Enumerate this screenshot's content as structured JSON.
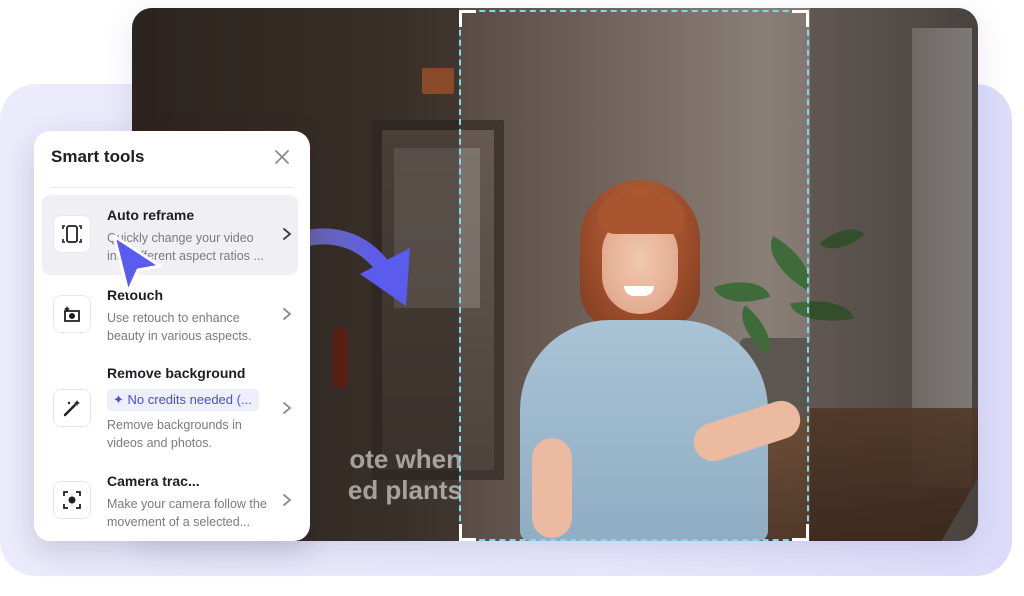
{
  "panel": {
    "title": "Smart tools",
    "close_icon": "close-icon",
    "tools": [
      {
        "title": "Auto reframe",
        "description": "Quickly change your video into different aspect ratios ...",
        "icon": "reframe-icon",
        "active": true
      },
      {
        "title": "Retouch",
        "description": "Use retouch to enhance beauty in various aspects.",
        "icon": "retouch-icon",
        "active": false
      },
      {
        "title": "Remove background",
        "badge": "✦ No credits needed (...",
        "description": "Remove backgrounds in videos and photos.",
        "icon": "magic-wand-icon",
        "active": false
      },
      {
        "title": "Camera trac...",
        "description": "Make your camera follow the movement of a selected...",
        "icon": "camera-track-icon",
        "active": false
      }
    ]
  },
  "video": {
    "overlay_text_line1": "ote when",
    "overlay_text_line2": "ed plants"
  },
  "colors": {
    "accent": "#5b5bf0",
    "badge_text": "#4b4fd0",
    "crop_frame": "#7fd7e8",
    "backdrop": "#e6e6fb"
  }
}
